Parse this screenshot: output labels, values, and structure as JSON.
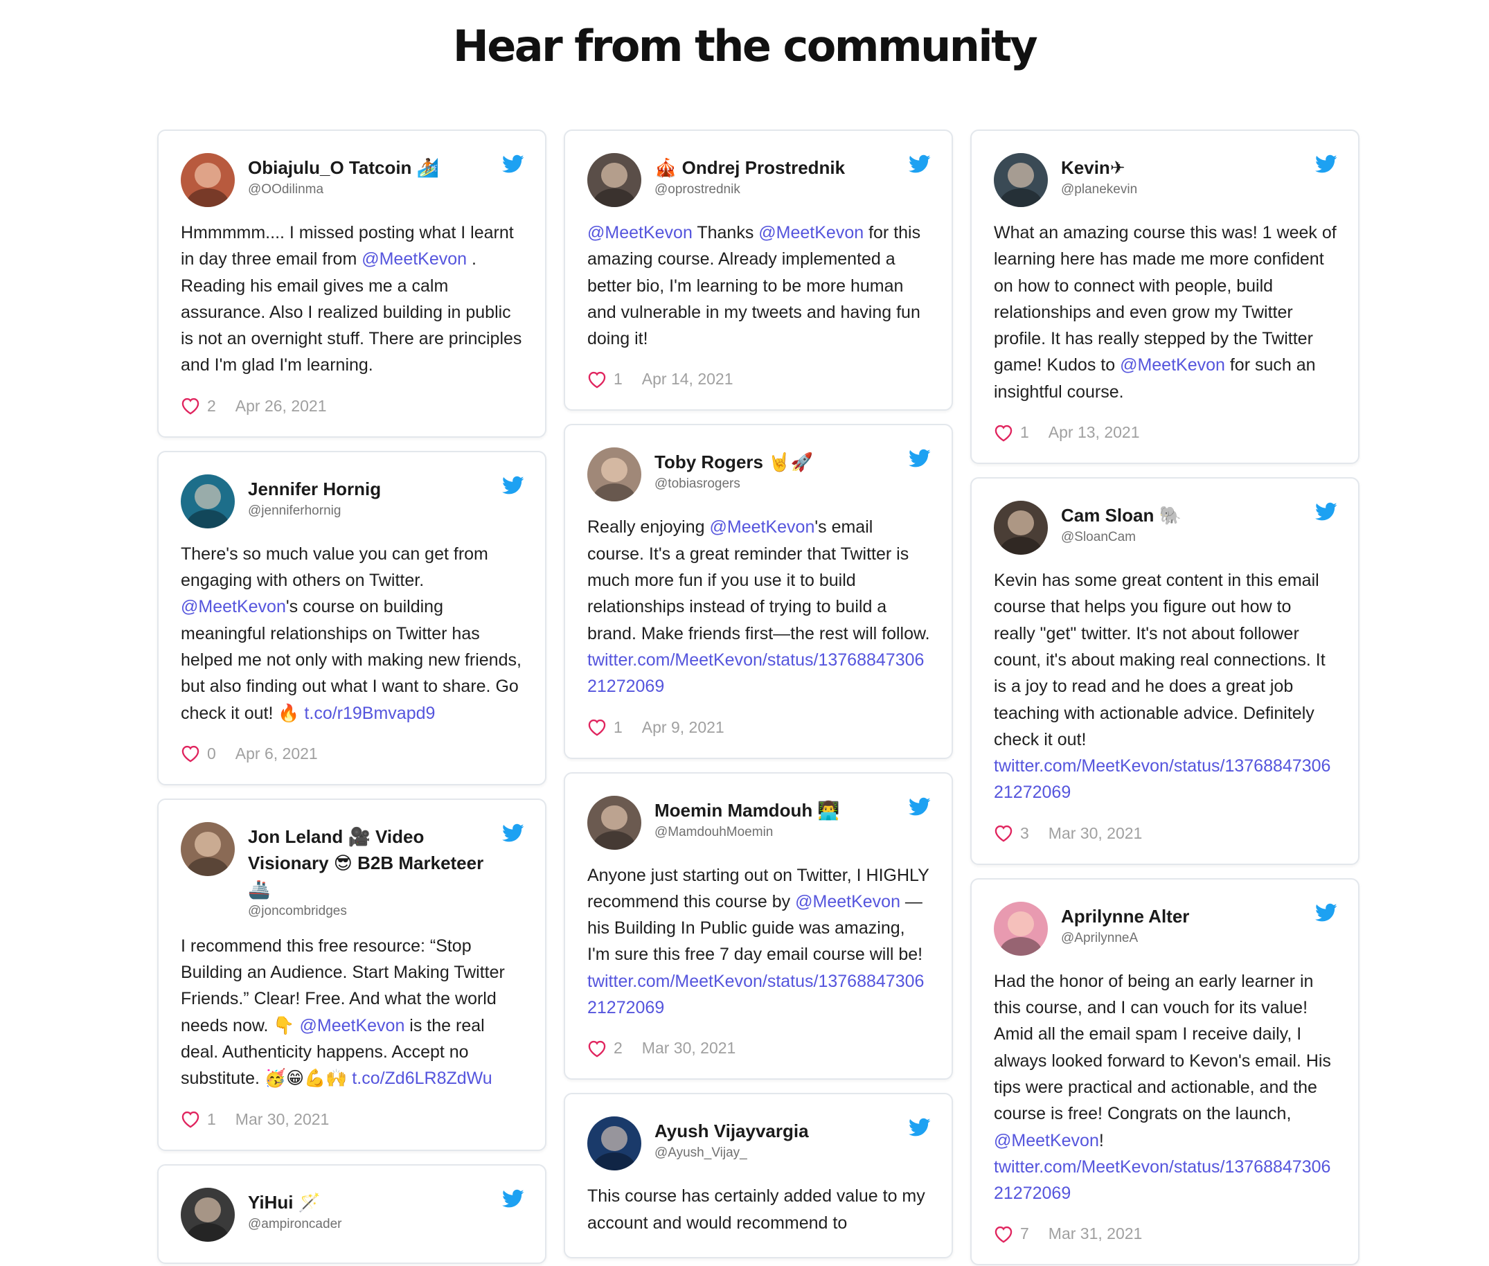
{
  "page": {
    "title": "Hear from the community"
  },
  "colors": {
    "mention": "#5555dd",
    "heart": "#e0245e",
    "bird": "#1da1f2"
  },
  "columns": [
    [
      {
        "name": "Obiajulu_O Tatcoin 🏄🏾",
        "handle": "@OOdilinma",
        "avatar_color": "#b85a3e",
        "segments": [
          {
            "t": "Hmmmmm.... I missed posting what I learnt in day three email from "
          },
          {
            "t": "@MeetKevon",
            "m": true
          },
          {
            "t": " . Reading his email gives me a calm assurance. Also I realized building in public is not an overnight stuff. There are principles and I'm glad I'm learning."
          }
        ],
        "likes": "2",
        "date": "Apr 26, 2021"
      },
      {
        "name": "Jennifer Hornig",
        "handle": "@jenniferhornig",
        "avatar_color": "#1d6e8a",
        "segments": [
          {
            "t": "There's so much value you can get from engaging with others on Twitter. "
          },
          {
            "t": "@MeetKevon",
            "m": true
          },
          {
            "t": "'s course on building meaningful relationships on Twitter has helped me not only with making new friends, but also finding out what I want to share. Go check it out! 🔥 "
          },
          {
            "t": "t.co/r19Bmvapd9",
            "l": true
          }
        ],
        "likes": "0",
        "date": "Apr 6, 2021"
      },
      {
        "name": "Jon Leland 🎥 Video Visionary 😎 B2B Marketeer 🚢",
        "handle": "@joncombridges",
        "avatar_color": "#8a6a55",
        "segments": [
          {
            "t": "I recommend this free resource: “Stop Building an Audience. Start Making Twitter Friends.” Clear! Free. And what the world needs now. 👇 "
          },
          {
            "t": "@MeetKevon",
            "m": true
          },
          {
            "t": " is the real deal. Authenticity happens. Accept no substitute. 🥳😁💪🙌 "
          },
          {
            "t": "t.co/Zd6LR8ZdWu",
            "l": true
          }
        ],
        "likes": "1",
        "date": "Mar 30, 2021"
      },
      {
        "name": "YiHui 🪄",
        "handle": "@ampironcader",
        "avatar_color": "#3a3a3a",
        "segments": [],
        "likes": "",
        "date": ""
      }
    ],
    [
      {
        "name": "🎪 Ondrej Prostrednik",
        "handle": "@oprostrednik",
        "avatar_color": "#5a4e48",
        "segments": [
          {
            "t": "@MeetKevon",
            "m": true
          },
          {
            "t": " Thanks "
          },
          {
            "t": "@MeetKevon",
            "m": true
          },
          {
            "t": " for this amazing course. Already implemented a better bio, I'm learning to be more human and vulnerable in my tweets and having fun doing it!"
          }
        ],
        "likes": "1",
        "date": "Apr 14, 2021"
      },
      {
        "name": "Toby Rogers 🤘🚀",
        "handle": "@tobiasrogers",
        "avatar_color": "#a08878",
        "segments": [
          {
            "t": "Really enjoying "
          },
          {
            "t": "@MeetKevon",
            "m": true
          },
          {
            "t": "'s email course. It's a great reminder that Twitter is much more fun if you use it to build relationships instead of trying to build a brand. Make friends first—the rest will follow. "
          },
          {
            "t": "twitter.com/MeetKevon/status/1376884730621272069",
            "l": true
          }
        ],
        "likes": "1",
        "date": "Apr 9, 2021"
      },
      {
        "name": "Moemin Mamdouh 👨‍💻",
        "handle": "@MamdouhMoemin",
        "avatar_color": "#6b5a50",
        "segments": [
          {
            "t": "Anyone just starting out on Twitter, I HIGHLY recommend this course by "
          },
          {
            "t": "@MeetKevon",
            "m": true
          },
          {
            "t": " — his Building In Public guide was amazing, I'm sure this free 7 day email course will be! "
          },
          {
            "t": "twitter.com/MeetKevon/status/1376884730621272069",
            "l": true
          }
        ],
        "likes": "2",
        "date": "Mar 30, 2021"
      },
      {
        "name": "Ayush Vijayvargia",
        "handle": "@Ayush_Vijay_",
        "avatar_color": "#1a3a6a",
        "segments": [
          {
            "t": "This course has certainly added value to my account and would recommend to"
          }
        ],
        "likes": "",
        "date": ""
      }
    ],
    [
      {
        "name": "Kevin✈",
        "handle": "@planekevin",
        "avatar_color": "#3a4a55",
        "segments": [
          {
            "t": "What an amazing course this was! 1 week of learning here has made me more confident on how to connect with people, build relationships and even grow my Twitter profile. It has really stepped by the Twitter game! Kudos to "
          },
          {
            "t": "@MeetKevon",
            "m": true
          },
          {
            "t": " for such an insightful course."
          }
        ],
        "likes": "1",
        "date": "Apr 13, 2021"
      },
      {
        "name": "Cam Sloan 🐘",
        "handle": "@SloanCam",
        "avatar_color": "#4a3e36",
        "segments": [
          {
            "t": "Kevin has some great content in this email course that helps you figure out how to really \"get\" twitter. It's not about follower count, it's about making real connections. It is a joy to read and he does a great job teaching with actionable advice. Definitely check it out! "
          },
          {
            "t": "twitter.com/MeetKevon/status/1376884730621272069",
            "l": true
          }
        ],
        "likes": "3",
        "date": "Mar 30, 2021"
      },
      {
        "name": "Aprilynne Alter",
        "handle": "@AprilynneA",
        "avatar_color": "#e89ab0",
        "segments": [
          {
            "t": "Had the honor of being an early learner in this course, and I can vouch for its value! Amid all the email spam I receive daily, I always looked forward to Kevon's email. His tips were practical and actionable, and the course is free! Congrats on the launch, "
          },
          {
            "t": "@MeetKevon",
            "m": true
          },
          {
            "t": "! "
          },
          {
            "t": "twitter.com/MeetKevon/status/1376884730621272069",
            "l": true
          }
        ],
        "likes": "7",
        "date": "Mar 31, 2021"
      }
    ]
  ]
}
